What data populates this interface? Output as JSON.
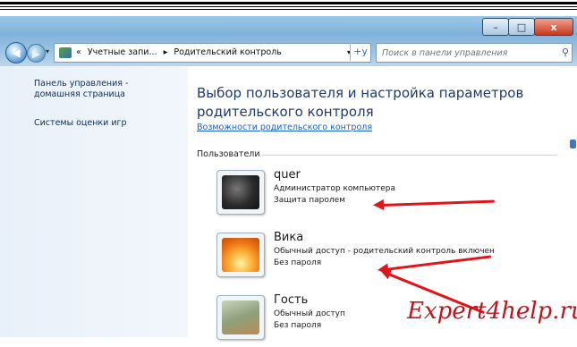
{
  "window": {
    "buttons": {
      "minimize": "–",
      "maximize": "□",
      "close": "x"
    }
  },
  "nav": {
    "back": "◀",
    "forward": "▶",
    "breadcrumb": [
      "«",
      "Учетные запи...",
      "▸",
      "Родительский контроль"
    ],
    "dropdown": "▾",
    "refresh": "+y",
    "search_placeholder": "Поиск в панели управления"
  },
  "sidebar": {
    "items": [
      {
        "label_line1": "Панель управления -",
        "label_line2": "домашняя страница"
      },
      {
        "label_line1": "Системы оценки игр",
        "label_line2": ""
      }
    ]
  },
  "main": {
    "title_line1": "Выбор пользователя и настройка параметров",
    "title_line2": "родительского контроля",
    "more_link": "Возможности родительского контроля",
    "section": "Пользователи",
    "users": [
      {
        "name": "quer",
        "role": "Администратор компьютера",
        "password": "Защита паролем"
      },
      {
        "name": "Вика",
        "role": "Обычный доступ - родительский контроль включен",
        "password": "Без пароля"
      },
      {
        "name": "Гость",
        "role": "Обычный доступ",
        "password": "Без пароля"
      }
    ]
  },
  "watermark": "Expert4help.ru",
  "colors": {
    "arrow": "#e0141a",
    "link": "#1660c8",
    "title": "#1e3a6b"
  }
}
